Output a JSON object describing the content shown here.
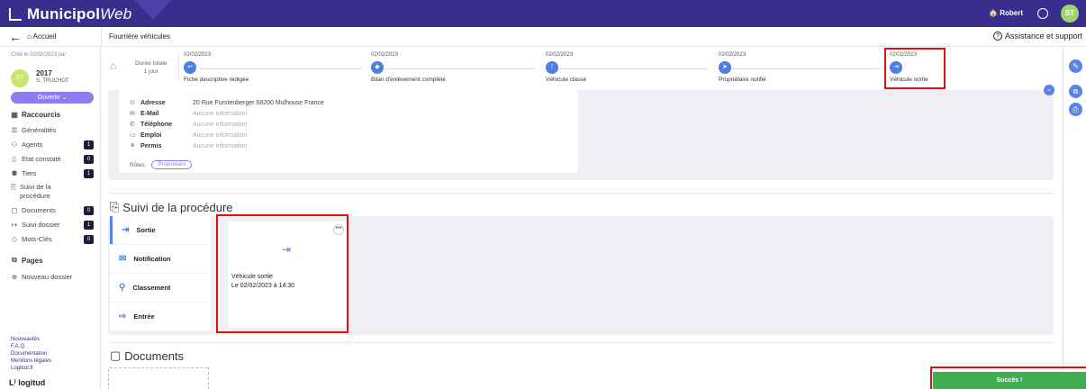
{
  "app": {
    "name_bold": "Municipol",
    "name_italic": "Web"
  },
  "topbar": {
    "user": "🏠 Robert",
    "avatar": "ST"
  },
  "nav": {
    "home": "Accueil",
    "page_title": "Fourrière véhicules",
    "assist": "Assistance et support"
  },
  "sidebar": {
    "created": "Créé le 02/02/2023 par",
    "avatar": "ST",
    "year": "2017",
    "author": "S. TRUCHOT",
    "status": "Ouverte",
    "shortcuts_title": "Raccourcis",
    "items": [
      {
        "label": "Généralités",
        "icon": "list-icon",
        "badge": ""
      },
      {
        "label": "Agents",
        "icon": "agents-icon",
        "badge": "1"
      },
      {
        "label": "Etat constaté",
        "icon": "check-icon",
        "badge": "0"
      },
      {
        "label": "Tiers",
        "icon": "people-icon",
        "badge": "1"
      },
      {
        "label": "Suivi de la procédure",
        "icon": "procedure-icon",
        "badge": ""
      },
      {
        "label": "Documents",
        "icon": "document-icon",
        "badge": "0"
      },
      {
        "label": "Suivi dossier",
        "icon": "arrow-icon",
        "badge": "1"
      },
      {
        "label": "Mots-Clés",
        "icon": "tag-icon",
        "badge": "0"
      }
    ],
    "pages": "Pages",
    "new_folder": "Nouveau dossier",
    "footer": [
      "Nouveautés",
      "F.A.Q.",
      "Documentation",
      "Mentions légales",
      "Logitud.fr"
    ],
    "brand": "logitud"
  },
  "timeline": {
    "duration_label": "Durée totale",
    "duration_value": "1 jour",
    "steps": [
      {
        "date": "02/02/2023",
        "label": "Fiche descriptive rédigée",
        "glyph": "↩"
      },
      {
        "date": "02/02/2023",
        "label": "Bilan d'enlèvement complété",
        "glyph": "◆"
      },
      {
        "date": "02/02/2023",
        "label": "Véhicule classé",
        "glyph": "!"
      },
      {
        "date": "02/02/2023",
        "label": "Propriétaire notifié",
        "glyph": "➤"
      },
      {
        "date": "02/02/2023",
        "label": "Véhicule sortie",
        "glyph": "⇥"
      }
    ]
  },
  "info": {
    "rows": [
      {
        "key": "Adresse",
        "value": "20 Rue Furstenberger 68200 Mulhouse France",
        "icon": "location-icon"
      },
      {
        "key": "E-Mail",
        "value": "Aucune information",
        "icon": "mail-icon"
      },
      {
        "key": "Téléphone",
        "value": "Aucune information",
        "icon": "phone-icon"
      },
      {
        "key": "Emploi",
        "value": "Aucune information",
        "icon": "job-icon"
      },
      {
        "key": "Permis",
        "value": "Aucune information",
        "icon": "license-icon"
      }
    ],
    "roles_label": "Rôles:",
    "role": "Propriétaire"
  },
  "procedure": {
    "title": "Suivi de la procédure",
    "items": [
      {
        "label": "Sortie",
        "glyph": "⇥"
      },
      {
        "label": "Notification",
        "glyph": "✉"
      },
      {
        "label": "Classement",
        "glyph": "⚲"
      },
      {
        "label": "Entrée",
        "glyph": "⇨"
      }
    ],
    "card_line1": "Véhicule sortie",
    "card_line2": "Le 02/02/2023 à 14:30",
    "card_more": "•••"
  },
  "documents": {
    "title": "Documents"
  },
  "toast": "Succès !"
}
